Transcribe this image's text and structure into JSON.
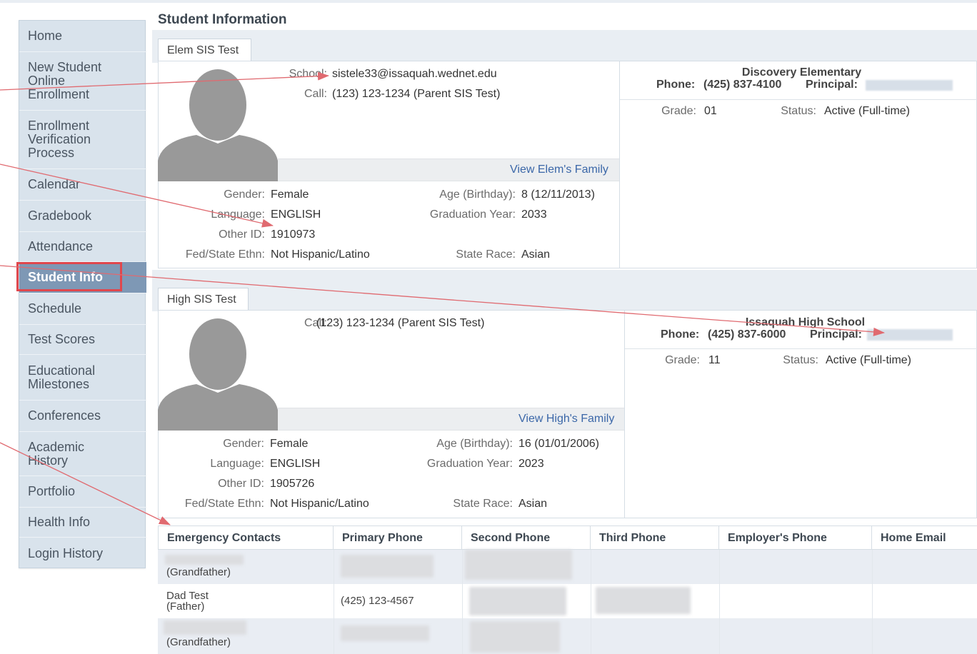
{
  "sidebar": {
    "items": [
      {
        "label": "Home"
      },
      {
        "label": "New Student Online Enrollment"
      },
      {
        "label": "Enrollment Verification Process"
      },
      {
        "label": "Calendar"
      },
      {
        "label": "Gradebook"
      },
      {
        "label": "Attendance"
      },
      {
        "label": "Student Info"
      },
      {
        "label": "Schedule"
      },
      {
        "label": "Test Scores"
      },
      {
        "label": "Educational Milestones"
      },
      {
        "label": "Conferences"
      },
      {
        "label": "Academic History"
      },
      {
        "label": "Portfolio"
      },
      {
        "label": "Health Info"
      },
      {
        "label": "Login History"
      }
    ],
    "active": "Student Info"
  },
  "page": {
    "title": "Student Information"
  },
  "students": [
    {
      "tab": "Elem SIS Test",
      "school_label": "School:",
      "school_value": "sistele33@issaquah.wednet.edu",
      "call_label": "Call:",
      "call_value": "(123) 123-1234 (Parent SIS Test)",
      "family_link": "View Elem's Family",
      "gender_label": "Gender:",
      "gender": "Female",
      "language_label": "Language:",
      "language": "ENGLISH",
      "other_id_label": "Other ID:",
      "other_id": "1910973",
      "ethn_label": "Fed/State Ethn:",
      "ethn": "Not Hispanic/Latino",
      "age_label": "Age (Birthday):",
      "age": "8 (12/11/2013)",
      "grad_label": "Graduation Year:",
      "grad_year": "2033",
      "race_label": "State Race:",
      "race": "Asian",
      "school_name": "Discovery Elementary",
      "phone_label": "Phone:",
      "phone": "(425) 837-4100",
      "principal_label": "Principal:",
      "grade_label": "Grade:",
      "grade": "01",
      "status_label": "Status:",
      "status": "Active (Full-time)"
    },
    {
      "tab": "High SIS Test",
      "call_label": "Call:",
      "call_value": "(123) 123-1234 (Parent SIS Test)",
      "family_link": "View High's Family",
      "gender_label": "Gender:",
      "gender": "Female",
      "language_label": "Language:",
      "language": "ENGLISH",
      "other_id_label": "Other ID:",
      "other_id": "1905726",
      "ethn_label": "Fed/State Ethn:",
      "ethn": "Not Hispanic/Latino",
      "age_label": "Age (Birthday):",
      "age": "16 (01/01/2006)",
      "grad_label": "Graduation Year:",
      "grad_year": "2023",
      "race_label": "State Race:",
      "race": "Asian",
      "school_name": "Issaquah High School",
      "phone_label": "Phone:",
      "phone": "(425) 837-6000",
      "principal_label": "Principal:",
      "grade_label": "Grade:",
      "grade": "11",
      "status_label": "Status:",
      "status": "Active (Full-time)"
    }
  ],
  "contacts": {
    "headers": [
      "Emergency Contacts",
      "Primary Phone",
      "Second Phone",
      "Third Phone",
      "Employer's Phone",
      "Home Email"
    ],
    "rows": [
      {
        "name": "",
        "relation": "(Grandfather)",
        "primary": ""
      },
      {
        "name": "Dad Test",
        "relation": "(Father)",
        "primary": "(425) 123-4567"
      },
      {
        "name": "",
        "relation": "(Grandfather)",
        "primary": ""
      }
    ]
  },
  "colors": {
    "active_nav": "#7e98b5",
    "highlight": "#e0474d",
    "link": "#3b67a8"
  }
}
